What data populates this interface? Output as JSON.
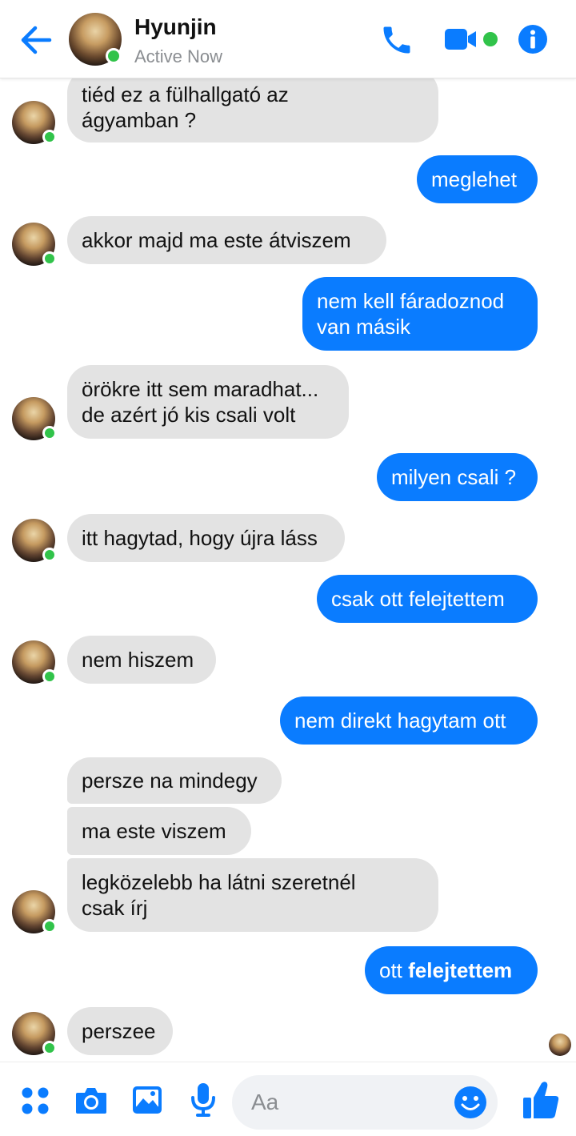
{
  "header": {
    "contact_name": "Hyunjin",
    "status": "Active Now",
    "icons": [
      "back-arrow-icon",
      "phone-icon",
      "video-camera-icon",
      "info-icon"
    ]
  },
  "colors": {
    "accent": "#0a7cff",
    "incoming_bubble": "#e3e3e3",
    "online": "#31c34a"
  },
  "messages": [
    {
      "dir": "in",
      "lines": [
        "tiéd ez a fülhallgató az",
        "ágyamban ?"
      ]
    },
    {
      "dir": "out",
      "lines": [
        "meglehet"
      ]
    },
    {
      "dir": "in",
      "lines": [
        "akkor majd ma este átviszem"
      ]
    },
    {
      "dir": "out",
      "lines": [
        "nem kell fáradoznod",
        "van másik"
      ]
    },
    {
      "dir": "in",
      "lines": [
        "örökre itt sem maradhat...",
        "de azért jó kis csali volt"
      ]
    },
    {
      "dir": "out",
      "lines": [
        "milyen csali ?"
      ]
    },
    {
      "dir": "in",
      "lines": [
        "itt hagytad, hogy újra láss"
      ]
    },
    {
      "dir": "out",
      "lines": [
        "csak ott felejtettem"
      ]
    },
    {
      "dir": "in",
      "lines": [
        "nem hiszem"
      ]
    },
    {
      "dir": "out",
      "lines": [
        "nem direkt hagytam ott"
      ]
    },
    {
      "dir": "in",
      "lines": [
        "persze na mindegy"
      ]
    },
    {
      "dir": "in",
      "lines": [
        "ma este viszem"
      ]
    },
    {
      "dir": "in",
      "lines": [
        "legközelebb ha látni szeretnél",
        "csak írj"
      ]
    },
    {
      "dir": "out",
      "lines": [
        "ott ",
        "felejtettem"
      ],
      "bold_second": true
    },
    {
      "dir": "in",
      "lines": [
        "perszee"
      ]
    }
  ],
  "composer": {
    "placeholder": "Aa",
    "icons": [
      "apps-grid-icon",
      "camera-icon",
      "photo-gallery-icon",
      "microphone-icon",
      "emoji-icon",
      "thumbs-up-icon"
    ]
  }
}
